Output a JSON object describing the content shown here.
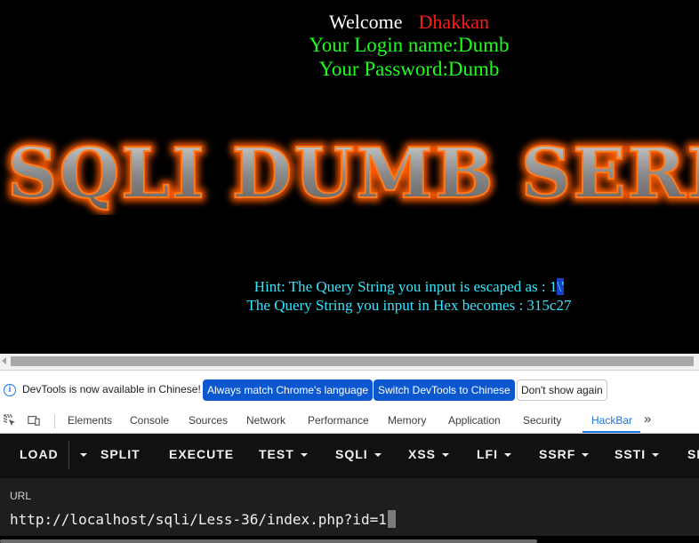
{
  "page": {
    "welcome_label": "Welcome",
    "welcome_user": "Dhakkan",
    "login_line": "Your Login name:Dumb",
    "password_line": "Your Password:Dumb",
    "banner_text": "SQLI DUMB SERIES",
    "hint_line_prefix": "Hint: The Query String you input is escaped as : 1",
    "hint_line_selected": "\\'",
    "hex_line": "The Query String you input in Hex becomes : 315c27"
  },
  "devtools": {
    "infobar": {
      "message": "DevTools is now available in Chinese!",
      "btn_match": "Always match Chrome's language",
      "btn_switch": "Switch DevTools to Chinese",
      "btn_dismiss": "Don't show again"
    },
    "tabs": [
      "Elements",
      "Console",
      "Sources",
      "Network",
      "Performance",
      "Memory",
      "Application",
      "Security",
      "HackBar"
    ],
    "active_tab": "HackBar",
    "more_tabs": "»"
  },
  "hackbar": {
    "toolbar": [
      "LOAD",
      "SPLIT",
      "EXECUTE",
      "TEST",
      "SQLI",
      "XSS",
      "LFI",
      "SSRF",
      "SSTI",
      "SH"
    ],
    "url_label": "URL",
    "url_value": "http://localhost/sqli/Less-36/index.php?id=1"
  },
  "colors": {
    "welcome_user": "#ff1a1a",
    "credentials": "#1aff1a",
    "hint": "#33e6ff",
    "accent": "#1a73e8",
    "blue_button": "#0b57d0"
  }
}
